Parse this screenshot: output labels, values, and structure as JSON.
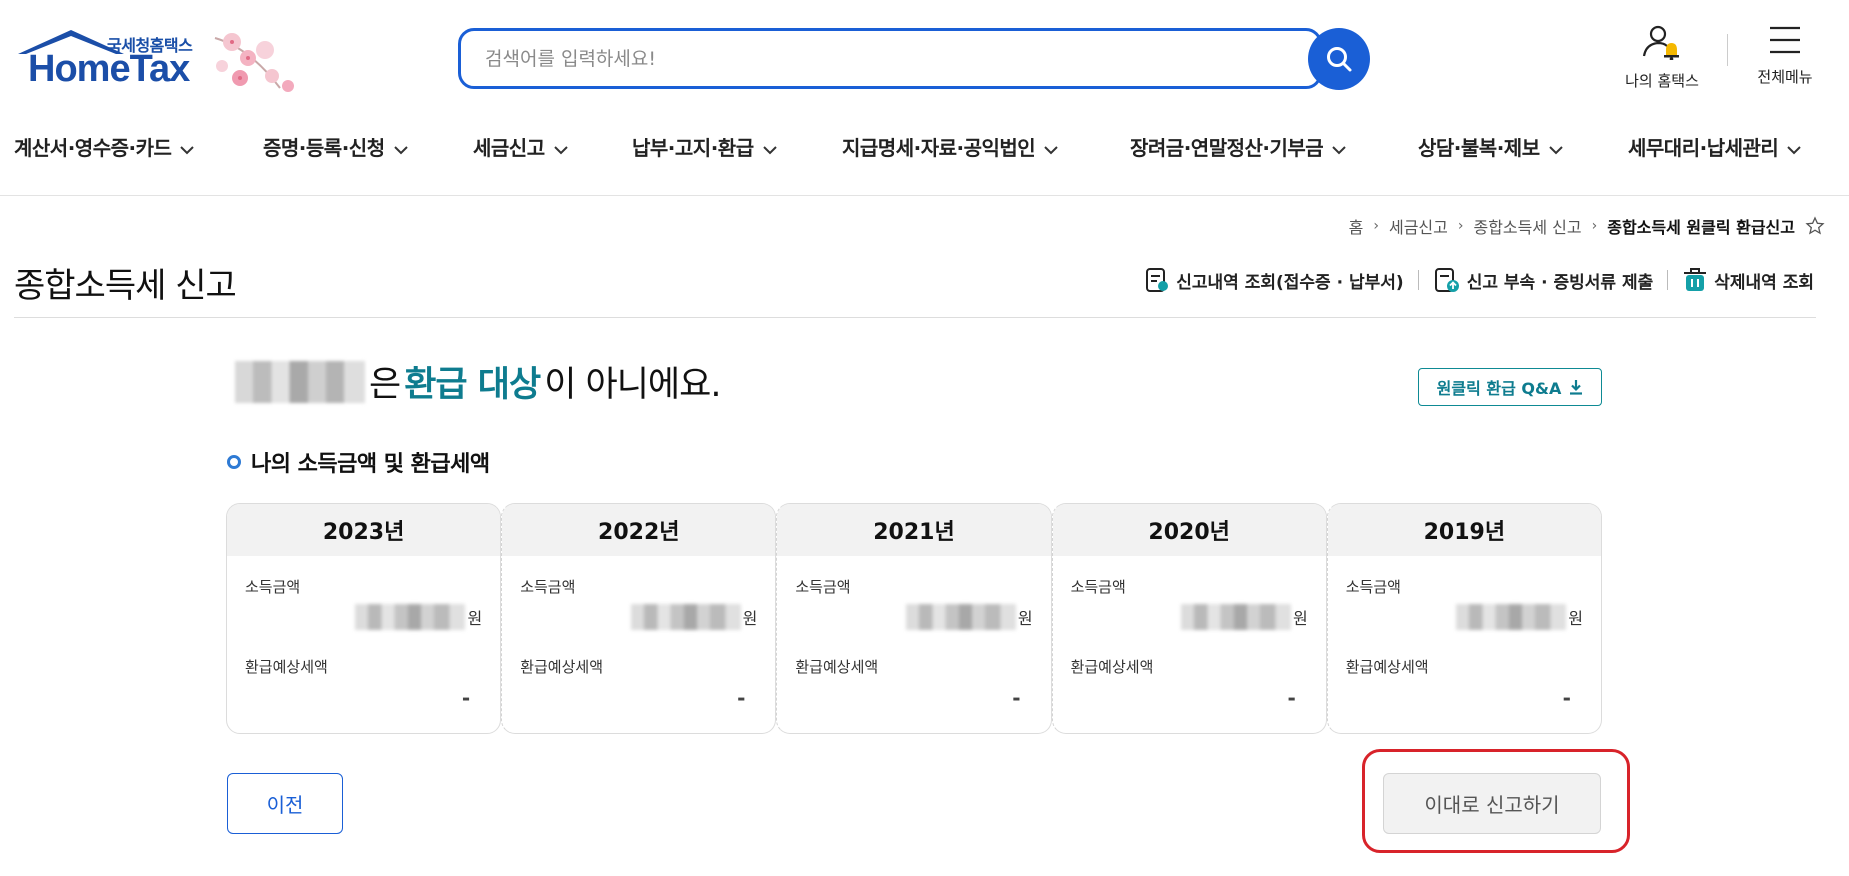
{
  "logo": {
    "top_text": "국세청홈택스",
    "main_text": "HomeTax"
  },
  "search": {
    "placeholder": "검색어를 입력하세요!"
  },
  "header": {
    "my_hometax": "나의 홈택스",
    "all_menu": "전체메뉴"
  },
  "nav": [
    {
      "label": "계산서·영수증·카드"
    },
    {
      "label": "증명·등록·신청"
    },
    {
      "label": "세금신고"
    },
    {
      "label": "납부·고지·환급"
    },
    {
      "label": "지급명세·자료·공익법인"
    },
    {
      "label": "장려금·연말정산·기부금"
    },
    {
      "label": "상담·불복·제보"
    },
    {
      "label": "세무대리·납세관리"
    }
  ],
  "breadcrumb": [
    {
      "label": "홈"
    },
    {
      "label": "세금신고"
    },
    {
      "label": "종합소득세 신고"
    },
    {
      "label": "종합소득세 원클릭 환급신고"
    }
  ],
  "page": {
    "title": "종합소득세 신고",
    "util_links": [
      {
        "label": "신고내역 조회(접수증 · 납부서)"
      },
      {
        "label": "신고 부속 · 증빙서류 제출"
      },
      {
        "label": "삭제내역 조회"
      }
    ]
  },
  "result": {
    "suffix_1": "은",
    "highlight": "환급 대상",
    "suffix_2": "이 아니에요.",
    "qa_button": "원클릭 환급 Q&A"
  },
  "section": {
    "title": "나의 소득금액 및 환급세액"
  },
  "years": [
    {
      "year": "2023년",
      "income_label": "소득금액",
      "income_unit": "원",
      "refund_label": "환급예상세액",
      "refund_value": "-"
    },
    {
      "year": "2022년",
      "income_label": "소득금액",
      "income_unit": "원",
      "refund_label": "환급예상세액",
      "refund_value": "-"
    },
    {
      "year": "2021년",
      "income_label": "소득금액",
      "income_unit": "원",
      "refund_label": "환급예상세액",
      "refund_value": "-"
    },
    {
      "year": "2020년",
      "income_label": "소득금액",
      "income_unit": "원",
      "refund_label": "환급예상세액",
      "refund_value": "-"
    },
    {
      "year": "2019년",
      "income_label": "소득금액",
      "income_unit": "원",
      "refund_label": "환급예상세액",
      "refund_value": "-"
    }
  ],
  "actions": {
    "prev": "이전",
    "submit": "이대로 신고하기"
  },
  "colors": {
    "brand_blue": "#1a5fd6",
    "highlight_teal": "#0e7c8f",
    "annotation_red": "#d8232a"
  }
}
